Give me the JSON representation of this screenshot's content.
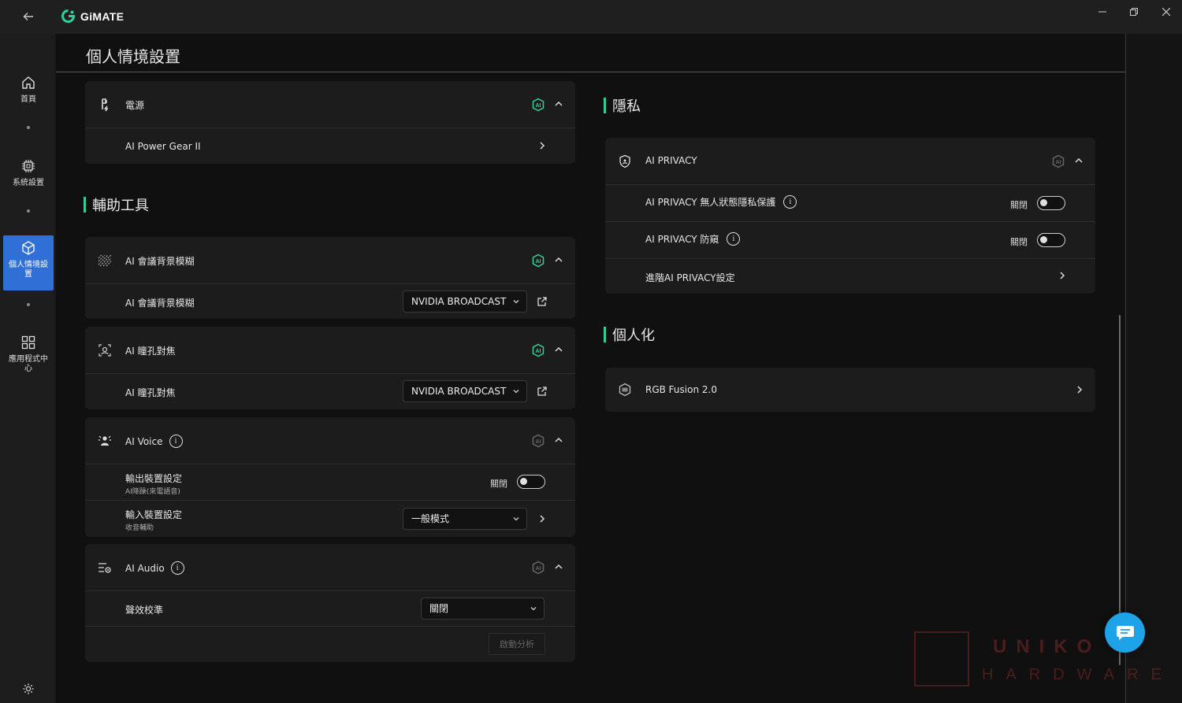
{
  "app": {
    "name": "GiMATE"
  },
  "page": {
    "title": "個人情境設置"
  },
  "sidebar": {
    "items": [
      {
        "label": "首頁",
        "icon": "home-icon"
      },
      {
        "label": "系統設置",
        "icon": "chip-icon"
      },
      {
        "label": "個人情境設置",
        "icon": "cube-icon",
        "active": true
      },
      {
        "label": "應用程式中心",
        "icon": "apps-grid-icon"
      }
    ]
  },
  "power": {
    "title": "電源",
    "rows": [
      {
        "label": "AI Power Gear II"
      }
    ]
  },
  "assist": {
    "section_title": "輔助工具",
    "blur": {
      "title": "AI 會議背景模糊",
      "row_label": "AI 會議背景模糊",
      "select_value": "NVIDIA BROADCAST"
    },
    "eye": {
      "title": "AI 瞳孔對焦",
      "row_label": "AI 瞳孔對焦",
      "select_value": "NVIDIA BROADCAST"
    },
    "voice": {
      "title": "AI Voice",
      "output_label": "輸出裝置設定",
      "output_sub": "AI降躁(來電語音)",
      "output_toggle_text": "關閉",
      "input_label": "輸入裝置設定",
      "input_sub": "收音輔助",
      "input_select": "一般模式"
    },
    "audio": {
      "title": "AI Audio",
      "row_label": "聲效校準",
      "select_value": "關閉",
      "analyze_button": "啟動分析"
    }
  },
  "privacy": {
    "section_title": "隱私",
    "card_title": "AI PRIVACY",
    "row1_label": "AI PRIVACY 無人狀態隱私保護",
    "row1_toggle_text": "關閉",
    "row2_label": "AI PRIVACY 防窺",
    "row2_toggle_text": "關閉",
    "row3_label": "進階AI PRIVACY設定"
  },
  "personal": {
    "section_title": "個人化",
    "rgb_label": "RGB Fusion 2.0"
  },
  "watermark": {
    "line1": "UNIKO",
    "line2": "HARDWARE"
  },
  "colors": {
    "accent": "#2ecf9a",
    "active_nav": "#2f6fd6",
    "chat": "#1ea3e8"
  }
}
